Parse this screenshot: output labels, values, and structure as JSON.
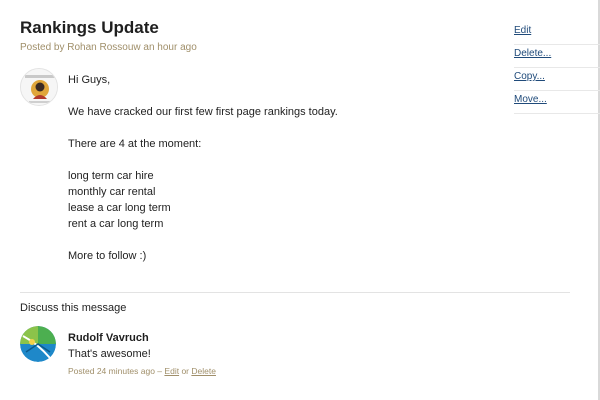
{
  "message": {
    "title": "Rankings Update",
    "posted_by": "Posted by Rohan Rossouw an hour ago",
    "body": {
      "greeting": "Hi Guys,",
      "line1": "We have cracked our first few first page rankings today.",
      "line2": "There are 4 at the moment:",
      "keywords": [
        "long term car hire",
        "monthly car rental",
        "lease a car long term",
        "rent a car long term"
      ],
      "closing": "More to follow :)"
    }
  },
  "actions": [
    "Edit",
    "Delete...",
    "Copy...",
    "Move..."
  ],
  "discussion": {
    "heading": "Discuss this message",
    "comments": [
      {
        "author": "Rudolf Vavruch",
        "text": "That's awesome!",
        "meta_prefix": "Posted 24 minutes ago –",
        "edit_label": "Edit",
        "or_label": "or",
        "delete_label": "Delete"
      }
    ]
  },
  "colors": {
    "meta_text": "#a08f6a",
    "link": "#1f4a7a",
    "avatar_green": "#8bc34a",
    "avatar_blue": "#1e88c9"
  },
  "icons": {
    "author_avatar": "avatar-image",
    "commenter_avatar": "avatar-image"
  }
}
